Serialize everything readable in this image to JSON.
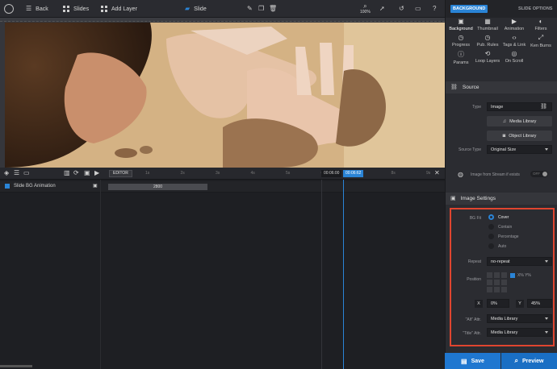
{
  "topbar": {
    "back": "Back",
    "slides": "Slides",
    "add_layer": "Add Layer",
    "slide": "Slide",
    "zoom": "100%"
  },
  "panel": {
    "tab_background": "BACKGROUND",
    "tab_slide_options": "SLIDE OPTIONS",
    "subtabs": [
      {
        "label": "Background",
        "icon": "image-icon"
      },
      {
        "label": "Thumbnail",
        "icon": "thumbnail-icon"
      },
      {
        "label": "Animation",
        "icon": "animation-icon"
      },
      {
        "label": "Filters",
        "icon": "filters-icon"
      },
      {
        "label": "Progress",
        "icon": "clock-icon"
      },
      {
        "label": "Pub. Rules",
        "icon": "clock-icon"
      },
      {
        "label": "Tags & Link",
        "icon": "code-icon"
      },
      {
        "label": "Ken Burns",
        "icon": "arrows-icon"
      },
      {
        "label": "Params",
        "icon": "info-icon"
      },
      {
        "label": "Loop Layers",
        "icon": "loop-icon"
      },
      {
        "label": "On Scroll",
        "icon": "scroll-icon"
      }
    ],
    "source": {
      "title": "Source",
      "type_label": "Type",
      "type_value": "Image",
      "media_library": "Media Library",
      "object_library": "Object Library",
      "source_type_label": "Source Type",
      "source_type_value": "Original Size",
      "stream_label": "Image from Stream if exists",
      "stream_toggle": "OFF"
    },
    "image_settings": {
      "title": "Image Settings",
      "bg_fit_label": "BG Fit",
      "fit_options": [
        "Cover",
        "Contain",
        "Percentage",
        "Auto"
      ],
      "fit_selected": "Cover",
      "repeat_label": "Repeat",
      "repeat_value": "no-repeat",
      "position_label": "Position",
      "xy_label": "X% Y%",
      "x_label": "X",
      "x_value": "0%",
      "y_label": "Y",
      "y_value": "45%",
      "alt_label": "\"Alt\" Attr.",
      "alt_value": "Media Library",
      "title_label": "\"Title\" Attr.",
      "title_value": "Media Library"
    },
    "save": "Save",
    "preview": "Preview"
  },
  "timeline": {
    "editor_label": "EDITOR",
    "ticks": [
      "1s",
      "2s",
      "3s",
      "4s",
      "5s",
      "6s",
      "7s",
      "8s",
      "9s"
    ],
    "time_current": "00:06:00",
    "time_end": "00:06:62",
    "row_label": "Slide BG Animation",
    "bar_value": "2800"
  },
  "colors": {
    "accent": "#2a84d6",
    "highlight_box": "#e0452f",
    "save_button": "#1f77d0",
    "preview_button": "#1a6fc4"
  }
}
